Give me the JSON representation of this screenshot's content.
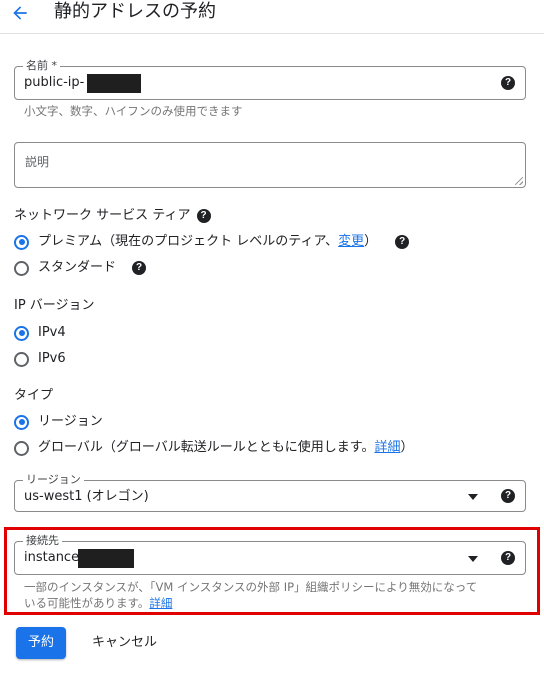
{
  "header": {
    "title": "静的アドレスの予約"
  },
  "name_field": {
    "label": "名前 *",
    "value_prefix": "public-ip-",
    "hint": "小文字、数字、ハイフンのみ使用できます"
  },
  "description_field": {
    "placeholder": "説明"
  },
  "network_tier": {
    "title": "ネットワーク サービス ティア",
    "options": [
      {
        "label_prefix": "プレミアム（現在のプロジェクト レベルのティア、",
        "link": "変更",
        "label_suffix": "）",
        "checked": true
      },
      {
        "label": "スタンダード",
        "checked": false
      }
    ]
  },
  "ip_version": {
    "title": "IP バージョン",
    "options": [
      {
        "label": "IPv4",
        "checked": true
      },
      {
        "label": "IPv6",
        "checked": false
      }
    ]
  },
  "type": {
    "title": "タイプ",
    "options": [
      {
        "label": "リージョン",
        "checked": true
      },
      {
        "label_prefix": "グローバル（グローバル転送ルールとともに使用します。",
        "link": "詳細",
        "label_suffix": "）",
        "checked": false
      }
    ]
  },
  "region_field": {
    "label": "リージョン",
    "value": "us-west1 (オレゴン)"
  },
  "attach_field": {
    "label": "接続先",
    "value_prefix": "instance-",
    "hint_line1": "一部のインスタンスが、「VM インスタンスの外部 IP」組織ポリシーにより無効になって",
    "hint_line2": "いる可能性があります。",
    "hint_link": "詳細"
  },
  "actions": {
    "reserve_label": "予約",
    "cancel_label": "キャンセル"
  },
  "colors": {
    "accent": "#1a73e8",
    "highlight": "#e00000"
  }
}
